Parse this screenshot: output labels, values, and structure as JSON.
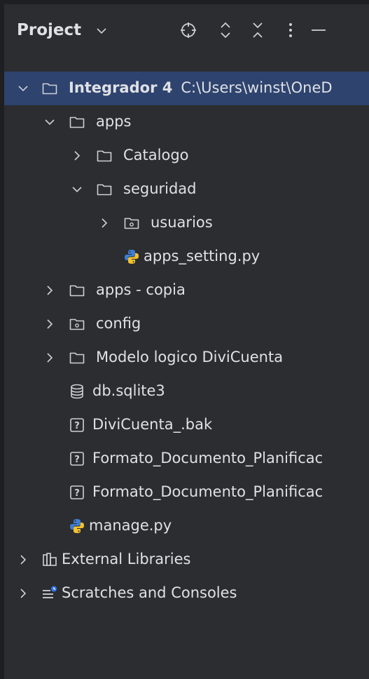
{
  "header": {
    "title": "Project",
    "icons": [
      "chevron-down-icon",
      "locate-icon",
      "expand-all-icon",
      "collapse-all-icon",
      "more-vert-icon",
      "minimize-icon"
    ]
  },
  "tree": {
    "root": {
      "name": "Integrador 4",
      "path": "C:\\Users\\winst\\OneD"
    },
    "apps": "apps",
    "catalogo": "Catalogo",
    "seguridad": "seguridad",
    "usuarios": "usuarios",
    "apps_setting": "apps_setting.py",
    "apps_copia": "apps - copia",
    "config": "config",
    "modelo": "Modelo logico DiviCuenta",
    "db": "db.sqlite3",
    "bak": "DiviCuenta_.bak",
    "formato1": "Formato_Documento_Planificac",
    "formato2": "Formato_Documento_Planificac",
    "manage": "manage.py",
    "external": "External Libraries",
    "scratches": "Scratches and Consoles"
  },
  "colors": {
    "background": "#2b2d30",
    "selection": "#2e436e",
    "text": "#dfe1e5",
    "icon": "#ced0d6",
    "python_blue": "#3d7ed3",
    "python_yellow": "#f2c12e",
    "scratch_blue": "#3574f0"
  }
}
